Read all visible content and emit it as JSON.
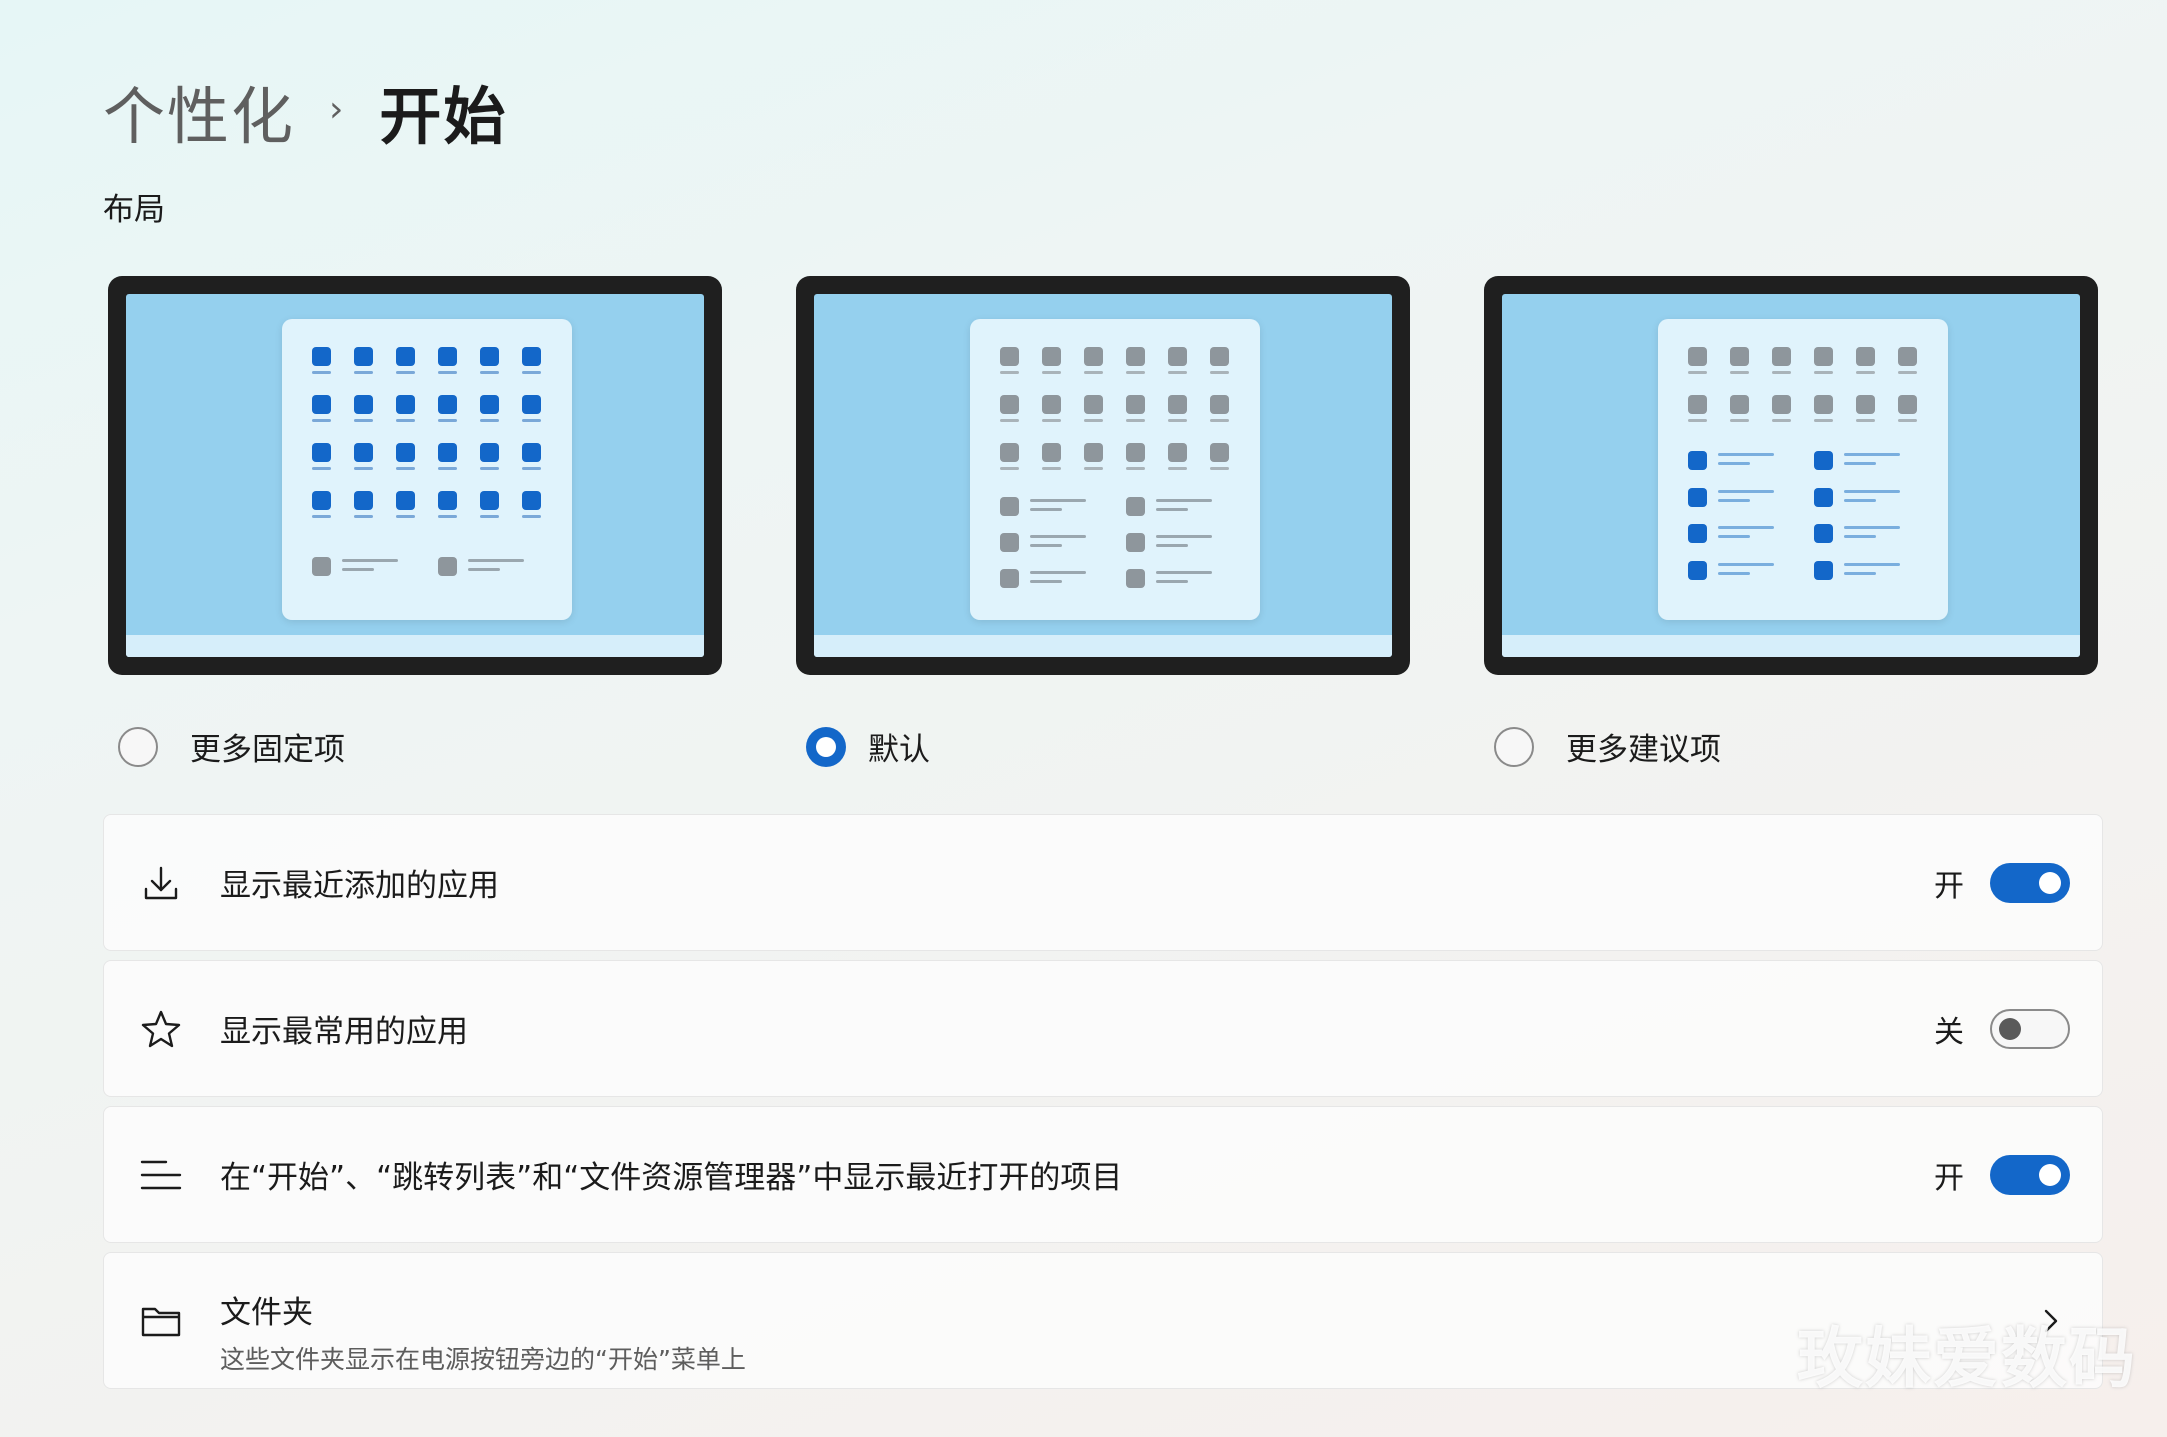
{
  "breadcrumb": {
    "parent": "个性化",
    "separator": "›",
    "current": "开始"
  },
  "layout_section": {
    "title": "布局",
    "options": [
      {
        "label": "更多固定项",
        "selected": false
      },
      {
        "label": "默认",
        "selected": true
      },
      {
        "label": "更多建议项",
        "selected": false
      }
    ]
  },
  "settings": {
    "recent_apps": {
      "label": "显示最近添加的应用",
      "state": "开",
      "on": true,
      "icon": "download-icon"
    },
    "most_used": {
      "label": "显示最常用的应用",
      "state": "关",
      "on": false,
      "icon": "star-icon"
    },
    "recent_items": {
      "label": "在“开始”、“跳转列表”和“文件资源管理器”中显示最近打开的项目",
      "state": "开",
      "on": true,
      "icon": "list-icon"
    },
    "folders": {
      "title": "文件夹",
      "subtitle": "这些文件夹显示在电源按钮旁边的“开始”菜单上",
      "icon": "folder-icon"
    }
  },
  "watermark": "玫妹爱数码",
  "colors": {
    "accent": "#1367c9",
    "screen": "#95d0ee",
    "bezel": "#1f1f1f"
  }
}
